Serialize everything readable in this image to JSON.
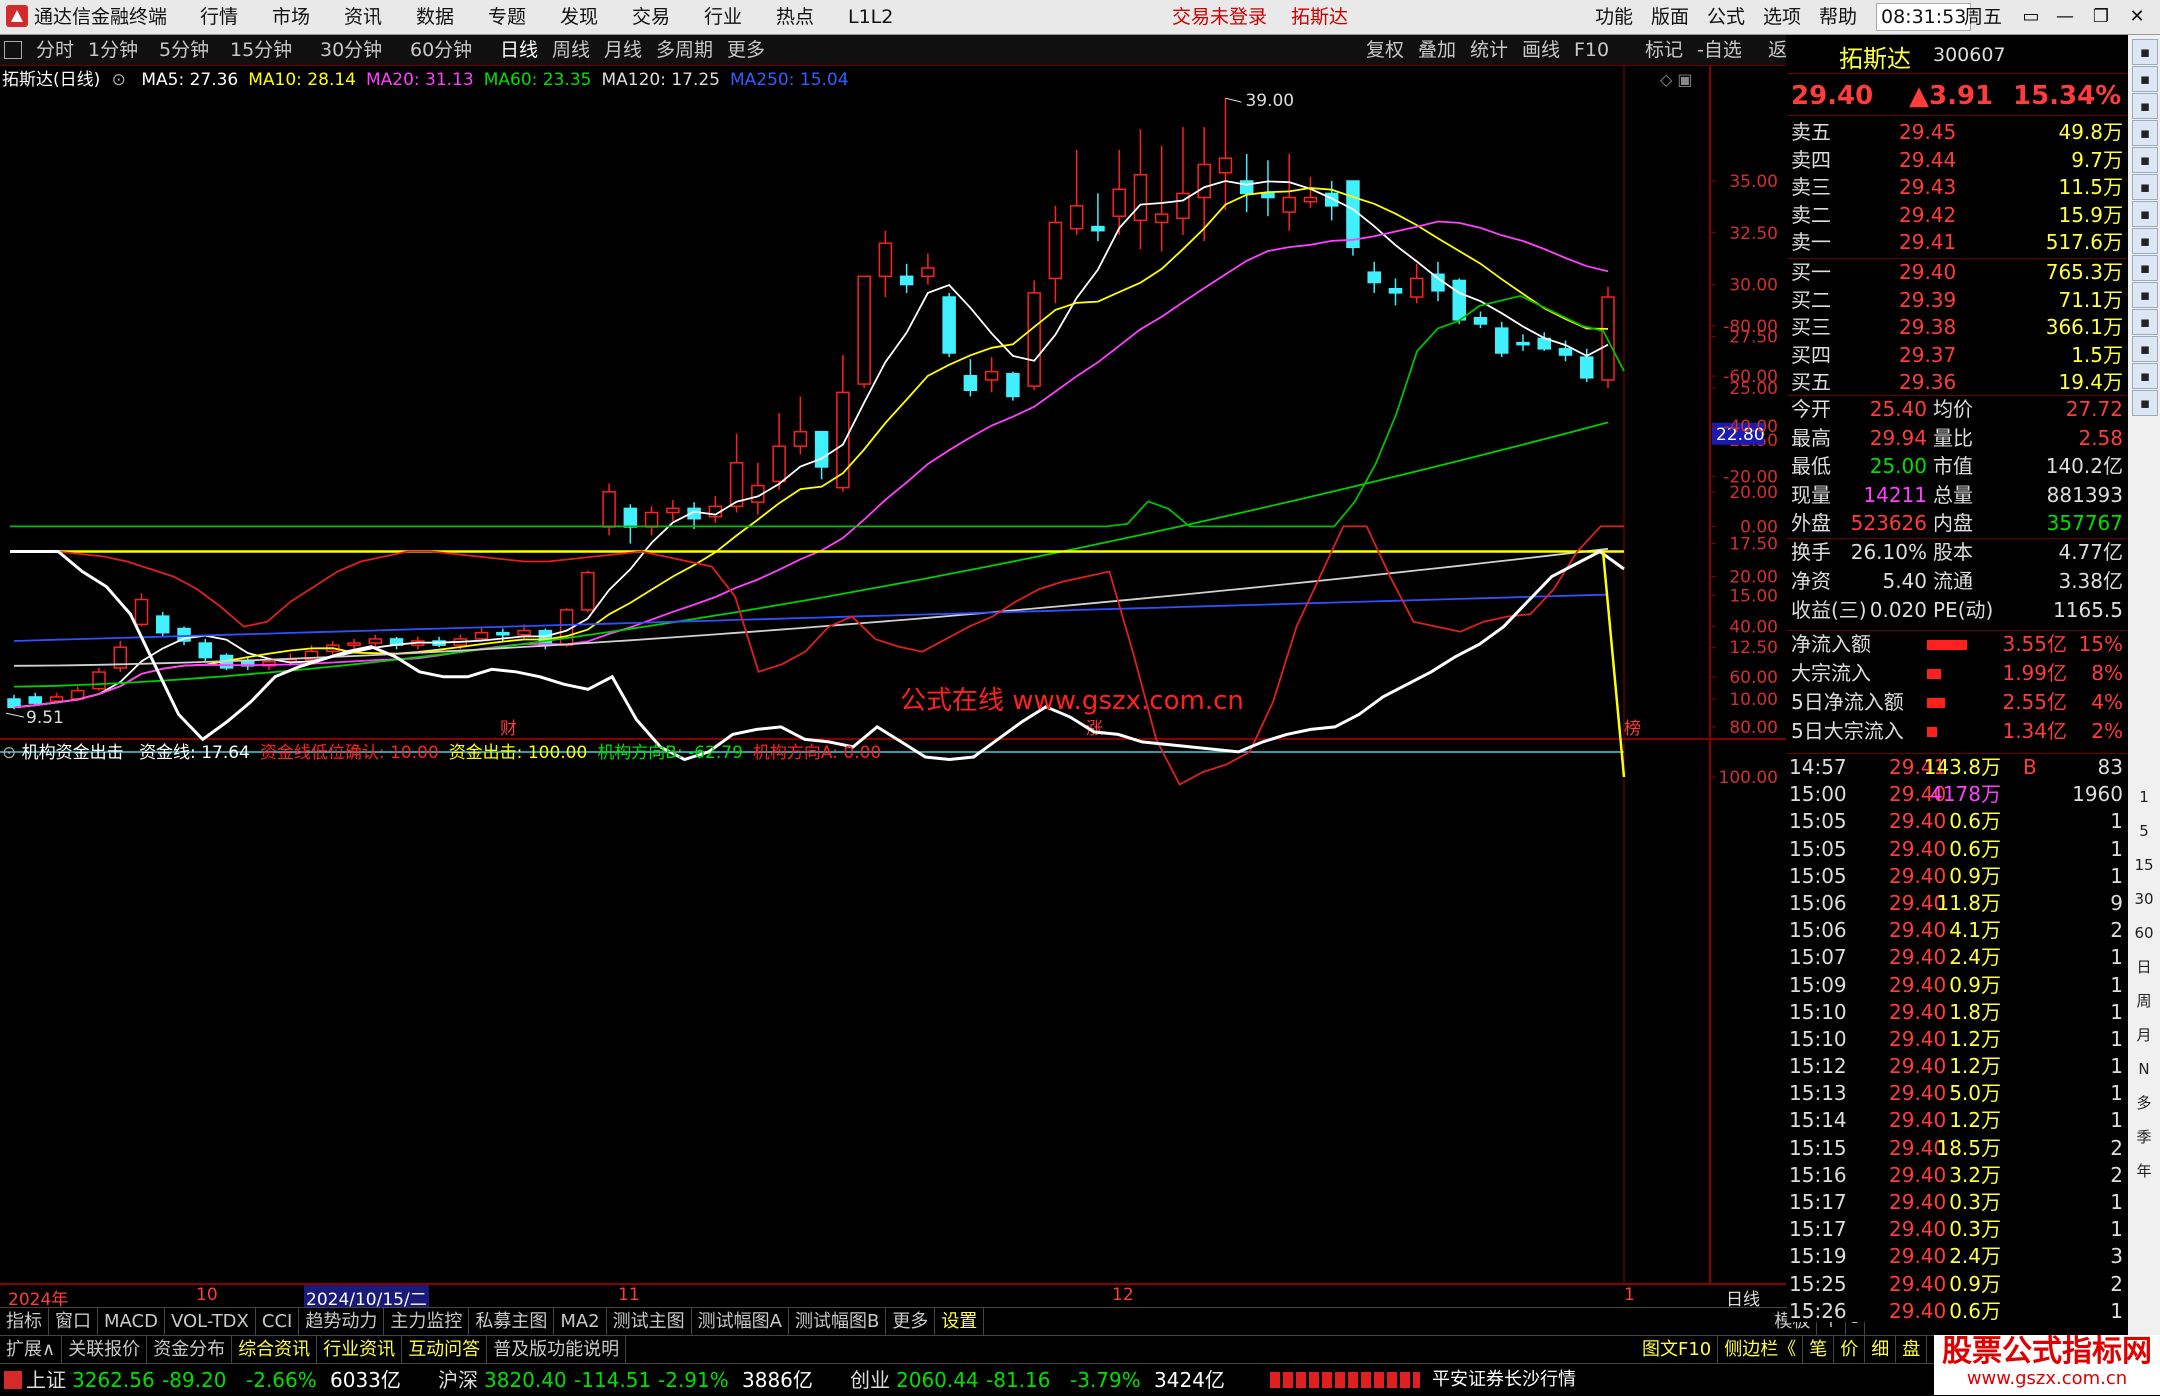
{
  "titlebar": {
    "app": "通达信金融终端",
    "menus": [
      "行情",
      "市场",
      "资讯",
      "数据",
      "专题",
      "发现",
      "交易",
      "行业",
      "热点",
      "L1L2"
    ],
    "trade_status": "交易未登录",
    "stock": "拓斯达",
    "right_menus": [
      "功能",
      "版面",
      "公式",
      "选项",
      "帮助"
    ],
    "time": "08:31:53",
    "weekday": "周五"
  },
  "periodbar": {
    "periods": [
      "分时",
      "1分钟",
      "5分钟",
      "15分钟",
      "30分钟",
      "60分钟",
      "日线",
      "周线",
      "月线",
      "多周期",
      "更多"
    ],
    "active": "日线",
    "tools": [
      "复权",
      "叠加",
      "统计",
      "画线",
      "F10",
      "标记",
      "-自选",
      "返回"
    ]
  },
  "legend": {
    "name": "拓斯达(日线)",
    "items": [
      {
        "label": "MA5: 27.36",
        "color": "#ffffff"
      },
      {
        "label": "MA10: 28.14",
        "color": "#ffff00"
      },
      {
        "label": "MA20: 31.13",
        "color": "#ff40ff"
      },
      {
        "label": "MA60: 23.35",
        "color": "#00e000"
      },
      {
        "label": "MA120: 17.25",
        "color": "#dddddd"
      },
      {
        "label": "MA250: 15.04",
        "color": "#3060ff"
      }
    ]
  },
  "main_axis": {
    "labels": [
      "35.00",
      "32.50",
      "30.00",
      "27.50",
      "25.00",
      "22.50",
      "20.00",
      "17.50",
      "15.00",
      "12.50",
      "10.00"
    ],
    "current_price_tag": "22.80",
    "high_mark": "39.00",
    "low_mark": "9.51",
    "watermark": "公式在线   www.gszx.com.cn",
    "markers": [
      "财",
      "涨",
      "榜"
    ]
  },
  "indicator": {
    "name": "机构资金出击",
    "items": [
      {
        "label": "资金线: 17.64",
        "color": "#ffffff"
      },
      {
        "label": "资金线低位确认: 10.00",
        "color": "#ff2020"
      },
      {
        "label": "资金出击: 100.00",
        "color": "#ffff00"
      },
      {
        "label": "机构方向B: -62.79",
        "color": "#00e000"
      },
      {
        "label": "机构方向A: 0.00",
        "color": "#ff2020"
      }
    ],
    "axis_labels": [
      "100.00",
      "80.00",
      "60.00",
      "40.00",
      "20.00",
      "0.00",
      "-20.00",
      "-40.00",
      "-60.00",
      "-80.00"
    ]
  },
  "time_axis": {
    "labels": [
      "2024年",
      "10",
      "2024/10/15/二",
      "11",
      "12",
      "1"
    ],
    "right": "日线"
  },
  "tabs_row1": [
    "指标",
    "窗口",
    "MACD",
    "VOL-TDX",
    "CCI",
    "趋势动力",
    "主力监控",
    "私募主图",
    "MA2",
    "测试主图",
    "测试幅图A",
    "测试幅图B",
    "更多",
    "设置"
  ],
  "tabs_row1_right": [
    "模板",
    "+",
    "-"
  ],
  "tabs_row2": [
    "扩展∧",
    "关联报价",
    "资金分布",
    "综合资讯",
    "行业资讯",
    "互动问答",
    "普及版功能说明"
  ],
  "tabs_row2_right": [
    "图文F10",
    "侧边栏《",
    "笔",
    "价",
    "细",
    "盘"
  ],
  "quote": {
    "name": "拓斯达",
    "code": "300607",
    "price": "29.40",
    "change": "▲3.91",
    "pct": "15.34%",
    "asks": [
      {
        "label": "卖五",
        "price": "29.45",
        "vol": "49.8万"
      },
      {
        "label": "卖四",
        "price": "29.44",
        "vol": "9.7万"
      },
      {
        "label": "卖三",
        "price": "29.43",
        "vol": "11.5万"
      },
      {
        "label": "卖二",
        "price": "29.42",
        "vol": "15.9万"
      },
      {
        "label": "卖一",
        "price": "29.41",
        "vol": "517.6万"
      }
    ],
    "bids": [
      {
        "label": "买一",
        "price": "29.40",
        "vol": "765.3万"
      },
      {
        "label": "买二",
        "price": "29.39",
        "vol": "71.1万"
      },
      {
        "label": "买三",
        "price": "29.38",
        "vol": "366.1万"
      },
      {
        "label": "买四",
        "price": "29.37",
        "vol": "1.5万"
      },
      {
        "label": "买五",
        "price": "29.36",
        "vol": "19.4万"
      }
    ],
    "stats": [
      {
        "k1": "今开",
        "v1": "25.40",
        "c1": "#ff3b3b",
        "k2": "均价",
        "v2": "27.72",
        "c2": "#ff3b3b"
      },
      {
        "k1": "最高",
        "v1": "29.94",
        "c1": "#ff3b3b",
        "k2": "量比",
        "v2": "2.58",
        "c2": "#ff3b3b"
      },
      {
        "k1": "最低",
        "v1": "25.00",
        "c1": "#00e000",
        "k2": "市值",
        "v2": "140.2亿",
        "c2": "#dddddd"
      },
      {
        "k1": "现量",
        "v1": "14211",
        "c1": "#ff40ff",
        "k2": "总量",
        "v2": "881393",
        "c2": "#dddddd"
      },
      {
        "k1": "外盘",
        "v1": "523626",
        "c1": "#ff3b3b",
        "k2": "内盘",
        "v2": "357767",
        "c2": "#00e000"
      }
    ],
    "stats2": [
      {
        "k1": "换手",
        "v1": "26.10%",
        "k2": "股本",
        "v2": "4.77亿"
      },
      {
        "k1": "净资",
        "v1": "5.40",
        "k2": "流通",
        "v2": "3.38亿"
      },
      {
        "k1": "收益(三)",
        "v1": "0.020",
        "k2": "PE(动)",
        "v2": "1165.5"
      }
    ],
    "flows": [
      {
        "label": "净流入额",
        "val": "3.55亿",
        "pct": "15%",
        "bar": 1
      },
      {
        "label": "大宗流入",
        "val": "1.99亿",
        "pct": "8%",
        "bar": 0.35
      },
      {
        "label": "5日净流入额",
        "val": "2.55亿",
        "pct": "4%",
        "bar": 0.45
      },
      {
        "label": "5日大宗流入",
        "val": "1.34亿",
        "pct": "2%",
        "bar": 0.25
      }
    ],
    "ticks": [
      {
        "t": "14:57",
        "p": "29.41",
        "v": "143.8万",
        "vc": "#ffff40",
        "f": "B",
        "n": "83"
      },
      {
        "t": "15:00",
        "p": "29.40",
        "v": "4178万",
        "vc": "#ff40ff",
        "f": "",
        "n": "1960"
      },
      {
        "t": "15:05",
        "p": "29.40",
        "v": "0.6万",
        "vc": "#ffff40",
        "f": "",
        "n": "1"
      },
      {
        "t": "15:05",
        "p": "29.40",
        "v": "0.6万",
        "vc": "#ffff40",
        "f": "",
        "n": "1"
      },
      {
        "t": "15:05",
        "p": "29.40",
        "v": "0.9万",
        "vc": "#ffff40",
        "f": "",
        "n": "1"
      },
      {
        "t": "15:06",
        "p": "29.40",
        "v": "11.8万",
        "vc": "#ffff40",
        "f": "",
        "n": "9"
      },
      {
        "t": "15:06",
        "p": "29.40",
        "v": "4.1万",
        "vc": "#ffff40",
        "f": "",
        "n": "2"
      },
      {
        "t": "15:07",
        "p": "29.40",
        "v": "2.4万",
        "vc": "#ffff40",
        "f": "",
        "n": "1"
      },
      {
        "t": "15:09",
        "p": "29.40",
        "v": "0.9万",
        "vc": "#ffff40",
        "f": "",
        "n": "1"
      },
      {
        "t": "15:10",
        "p": "29.40",
        "v": "1.8万",
        "vc": "#ffff40",
        "f": "",
        "n": "1"
      },
      {
        "t": "15:10",
        "p": "29.40",
        "v": "1.2万",
        "vc": "#ffff40",
        "f": "",
        "n": "1"
      },
      {
        "t": "15:12",
        "p": "29.40",
        "v": "1.2万",
        "vc": "#ffff40",
        "f": "",
        "n": "1"
      },
      {
        "t": "15:13",
        "p": "29.40",
        "v": "5.0万",
        "vc": "#ffff40",
        "f": "",
        "n": "1"
      },
      {
        "t": "15:14",
        "p": "29.40",
        "v": "1.2万",
        "vc": "#ffff40",
        "f": "",
        "n": "1"
      },
      {
        "t": "15:15",
        "p": "29.40",
        "v": "18.5万",
        "vc": "#ffff40",
        "f": "",
        "n": "2"
      },
      {
        "t": "15:16",
        "p": "29.40",
        "v": "3.2万",
        "vc": "#ffff40",
        "f": "",
        "n": "2"
      },
      {
        "t": "15:17",
        "p": "29.40",
        "v": "0.3万",
        "vc": "#ffff40",
        "f": "",
        "n": "1"
      },
      {
        "t": "15:17",
        "p": "29.40",
        "v": "0.3万",
        "vc": "#ffff40",
        "f": "",
        "n": "1"
      },
      {
        "t": "15:19",
        "p": "29.40",
        "v": "2.4万",
        "vc": "#ffff40",
        "f": "",
        "n": "3"
      },
      {
        "t": "15:25",
        "p": "29.40",
        "v": "0.9万",
        "vc": "#ffff40",
        "f": "",
        "n": "2"
      },
      {
        "t": "15:26",
        "p": "29.40",
        "v": "0.6万",
        "vc": "#ffff40",
        "f": "",
        "n": "1"
      }
    ]
  },
  "sidebar_labels": [
    "1",
    "5",
    "15",
    "30",
    "60",
    "日",
    "周",
    "月",
    "N",
    "多",
    "季",
    "年"
  ],
  "statusbar": [
    {
      "name": "上证",
      "val": "3262.56",
      "chg": "-89.20",
      "pct": "-2.66%",
      "amt": "6033亿"
    },
    {
      "name": "沪深",
      "val": "3820.40",
      "chg": "-114.51",
      "pct": "-2.91%",
      "amt": "3886亿"
    },
    {
      "name": "创业",
      "val": "2060.44",
      "chg": "-81.16",
      "pct": "-3.79%",
      "amt": "3424亿"
    }
  ],
  "status_right": "平安证券长沙行情",
  "site_badge": {
    "line1": "股票公式指标网",
    "line2": "www.gszx.com.cn"
  }
}
